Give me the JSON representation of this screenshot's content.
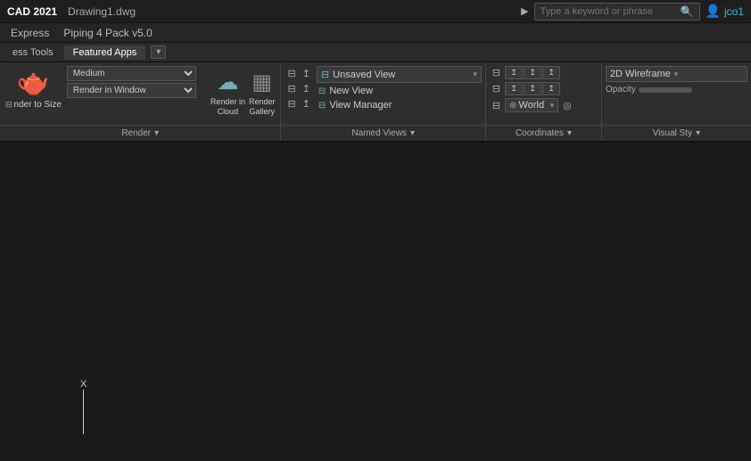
{
  "titlebar": {
    "app_name": "CAD 2021",
    "file_name": "Drawing1.dwg",
    "search_placeholder": "Type a keyword or phrase",
    "search_arrow": "▶",
    "user": "jco1"
  },
  "menubar": {
    "items": [
      "Express",
      "Piping 4 Pack v5.0"
    ]
  },
  "tabbar": {
    "tabs": [
      "ess Tools",
      "Featured Apps"
    ],
    "extra_btn": "▾"
  },
  "ribbon": {
    "render_section": {
      "quality_options": [
        "Medium"
      ],
      "quality_selected": "Medium",
      "output_options": [
        "Render in Window"
      ],
      "output_selected": "Render in Window",
      "size_label": "nder to Size",
      "label": "Render",
      "label_arrow": "▾"
    },
    "render_buttons": {
      "cloud_label": "Render in\nCloud",
      "gallery_label": "Render\nGallery"
    },
    "named_views": {
      "label": "Named Views",
      "label_arrow": "▾",
      "current_view": "Unsaved View",
      "items": [
        "New View",
        "View Manager"
      ]
    },
    "coordinates": {
      "label": "Coordinates",
      "label_arrow": "▾",
      "ucs_name": "World",
      "rows": [
        [
          "btn",
          "btn",
          "btn",
          "btn"
        ],
        [
          "btn",
          "btn",
          "btn",
          "btn"
        ],
        [
          "btn",
          "btn",
          "btn",
          "btn"
        ]
      ]
    },
    "visual_style": {
      "label": "Visual Sty",
      "label_arrow": "▾",
      "style": "2D Wireframe",
      "opacity_label": "Opacity"
    }
  },
  "canvas": {
    "axis_x": "X",
    "bg_color": "#1a1a1a"
  },
  "icons": {
    "teapot": "🫖",
    "search": "🔍",
    "user": "👤",
    "cloud": "☁",
    "gallery": "▦",
    "view": "⊟",
    "ucs": "⊕",
    "arrow_down": "▾",
    "arrow_right": "▶"
  }
}
